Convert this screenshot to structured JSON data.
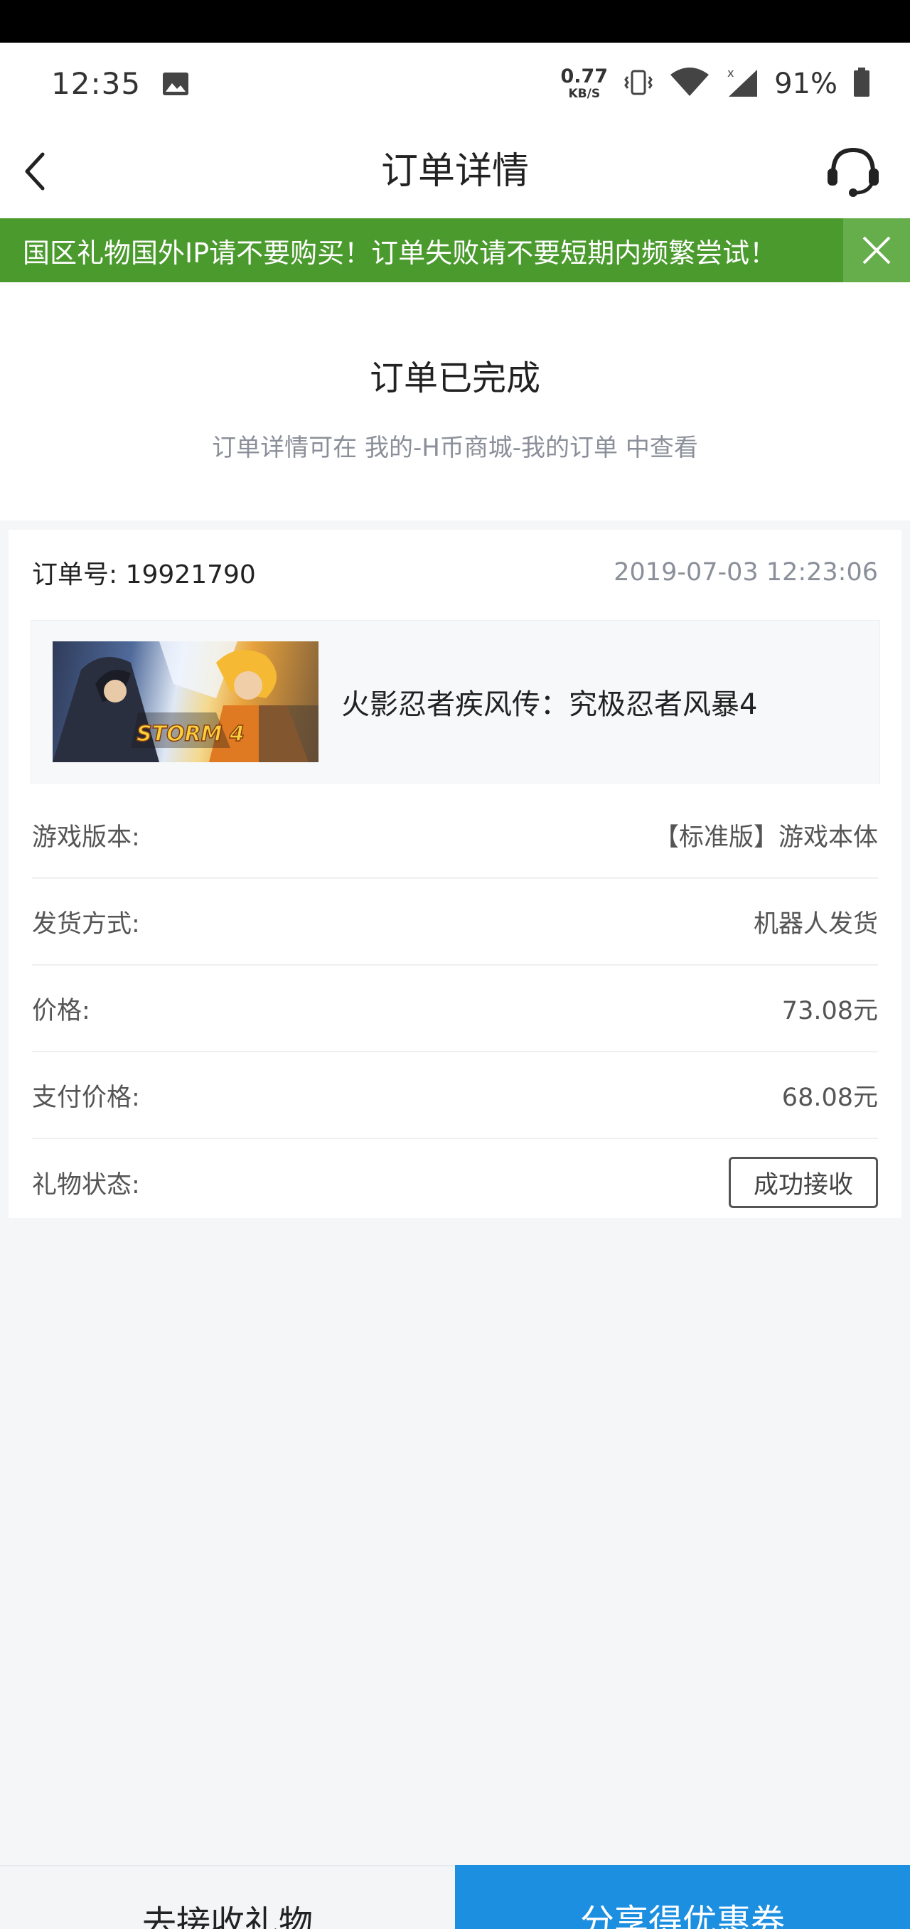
{
  "status_bar": {
    "time": "12:35",
    "net_speed_value": "0.77",
    "net_speed_unit": "KB/S",
    "battery_percent": "91%",
    "icons": [
      "image-icon",
      "vibrate-icon",
      "wifi-icon",
      "cell-signal-icon",
      "battery-icon"
    ]
  },
  "nav": {
    "title": "订单详情",
    "back_icon": "chevron-left-icon",
    "service_icon": "headset-icon"
  },
  "notice": {
    "text": "国区礼物国外IP请不要购买！订单失败请不要短期内频繁尝试！",
    "close_icon": "close-icon",
    "background_color": "#4b9a2e"
  },
  "completion": {
    "title": "订单已完成",
    "subtitle": "订单详情可在 我的-H币商城-我的订单 中查看"
  },
  "order": {
    "number_label": "订单号: 19921790",
    "datetime": "2019-07-03 12:23:06",
    "product": {
      "name": "火影忍者疾风传：究极忍者风暴4",
      "image_logo_text": "STORM 4"
    },
    "rows": [
      {
        "label": "游戏版本:",
        "value": "【标准版】游戏本体"
      },
      {
        "label": "发货方式:",
        "value": "机器人发货"
      },
      {
        "label": "价格:",
        "value": "73.08元"
      },
      {
        "label": "支付价格:",
        "value": "68.08元"
      }
    ],
    "gift_status": {
      "label": "礼物状态:",
      "value": "成功接收"
    }
  },
  "bottom_buttons": {
    "receive_label": "去接收礼物",
    "share_label": "分享得优惠券",
    "share_color": "#1d8fe0"
  }
}
